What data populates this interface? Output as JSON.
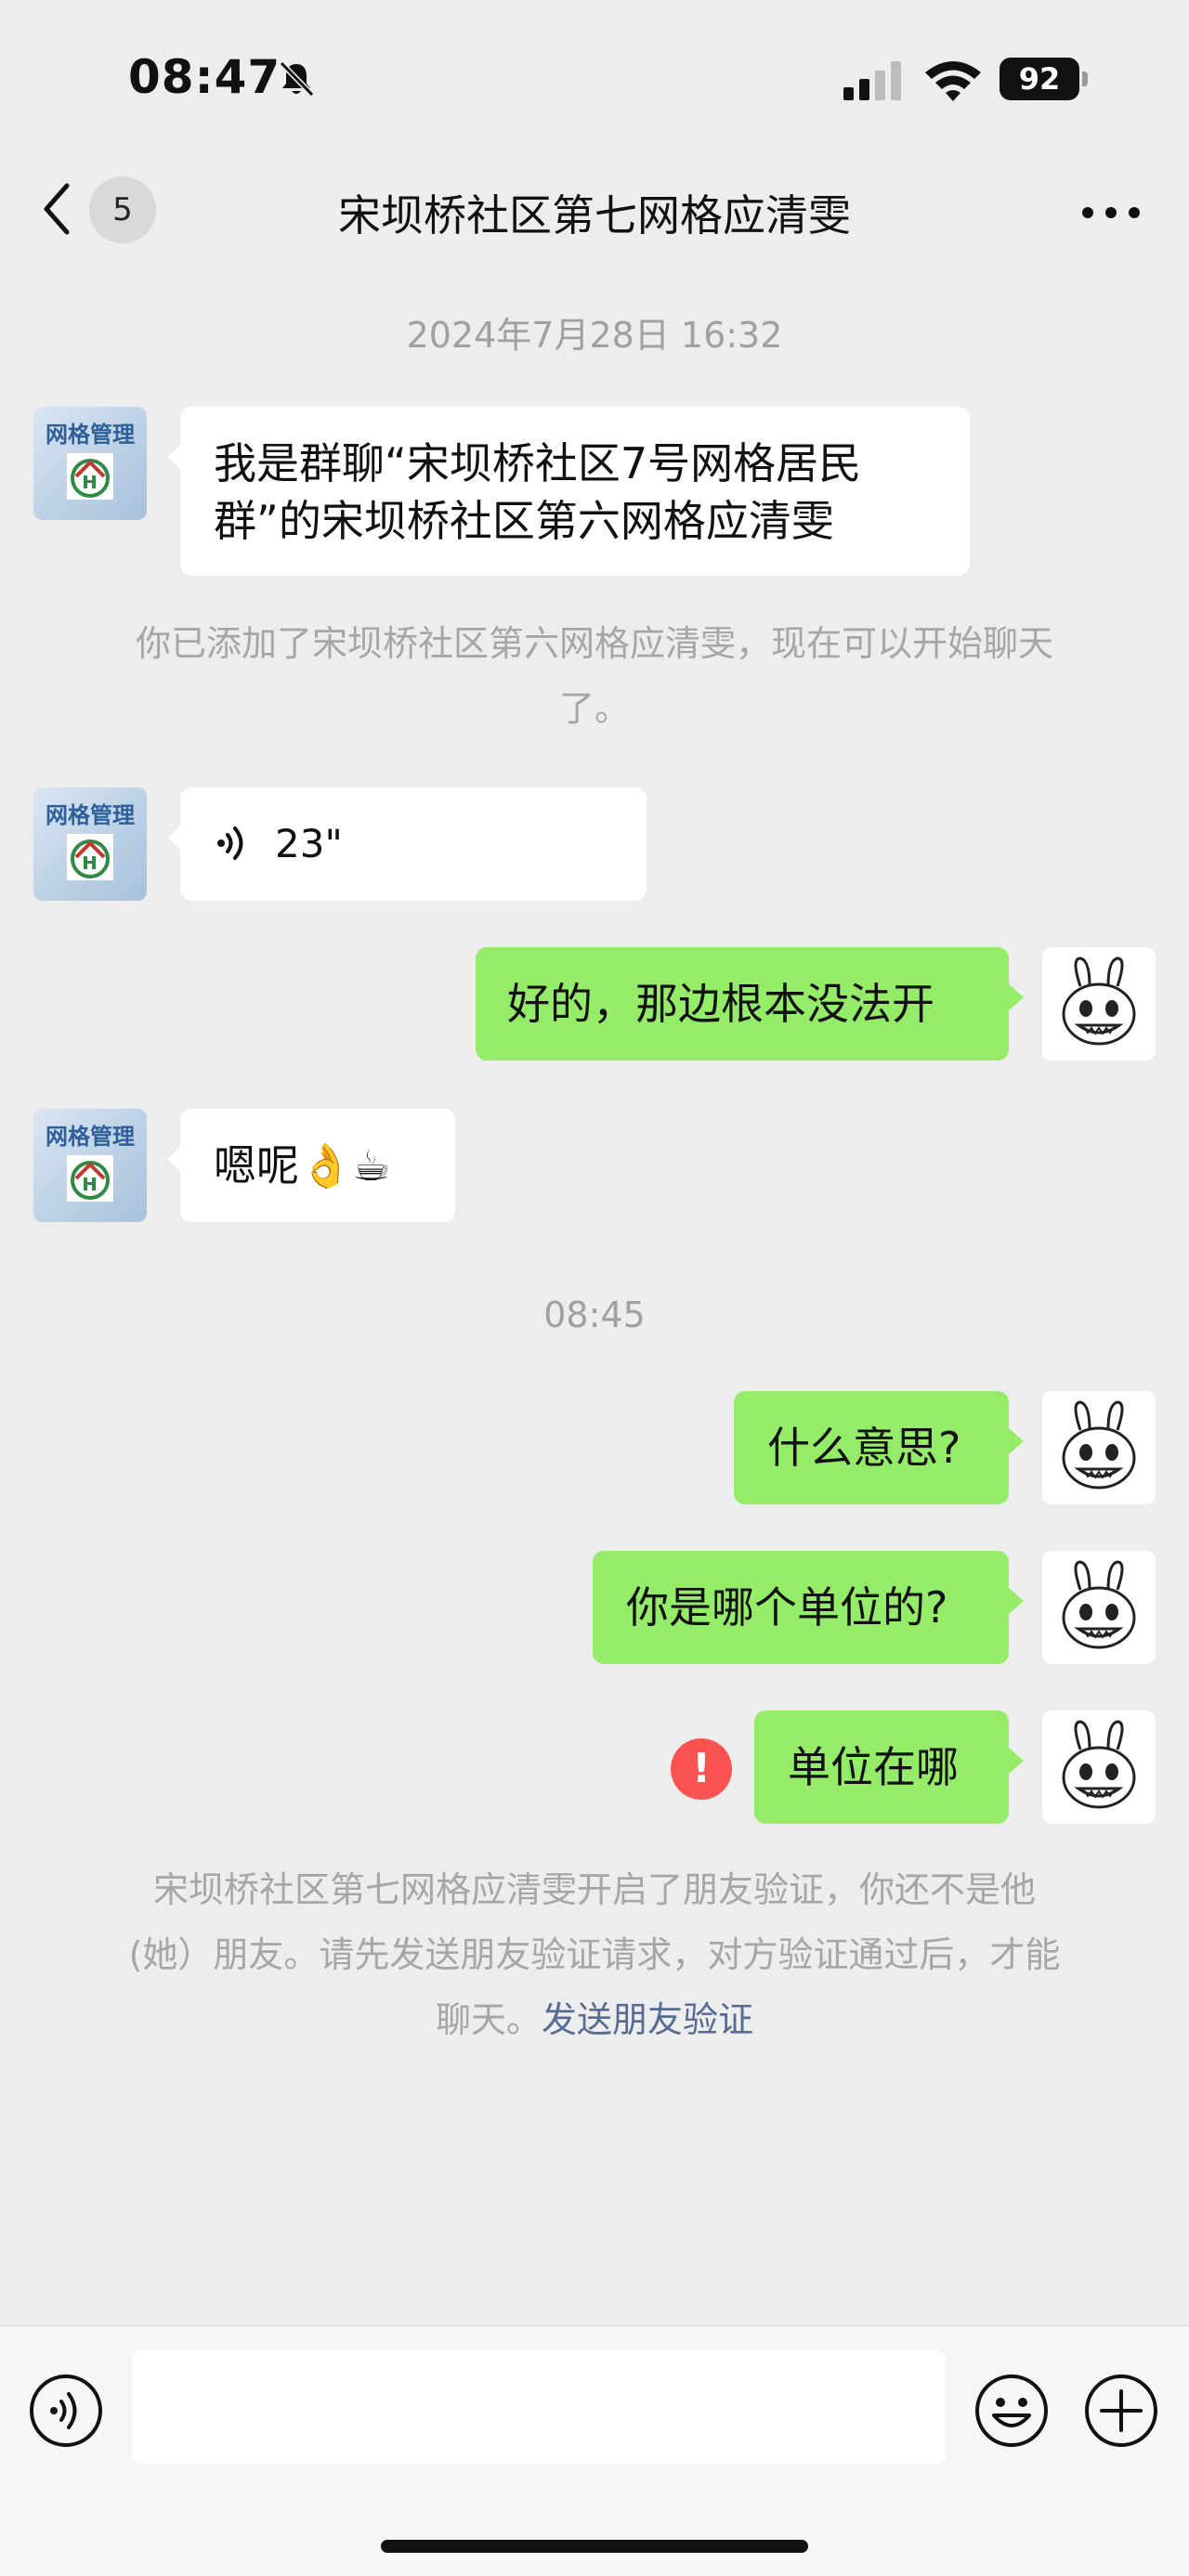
{
  "status_bar": {
    "time": "08:47",
    "battery": "92"
  },
  "header": {
    "unread_count": "5",
    "title": "宋坝桥社区第七网格应清雯"
  },
  "avatar_label": "网格管理",
  "messages": [
    {
      "timestamp": "2024年7月28日 16:32"
    },
    {
      "text": "我是群聊“宋坝桥社区7号网格居民",
      "text2": "群”的宋坝桥社区第六网格应清雯"
    },
    {
      "system1": "你已添加了宋坝桥社区第六网格应清雯，现在可以开始聊天",
      "system2": "了。"
    },
    {
      "voice_duration": "23\""
    },
    {
      "text": "好的，那边根本没法开"
    },
    {
      "text": "嗯呢👌☕"
    },
    {
      "timestamp": "08:45"
    },
    {
      "text": "什么意思?"
    },
    {
      "text": "你是哪个单位的?"
    },
    {
      "text": "单位在哪",
      "error_mark": "!"
    }
  ],
  "footer_notice": {
    "line1": "宋坝桥社区第七网格应清雯开启了朋友验证，你还不是他",
    "line2": "(她）朋友。请先发送朋友验证请求，对方验证通过后，才能",
    "line3": "聊天。",
    "link": "发送朋友验证"
  },
  "input": {
    "placeholder": ""
  },
  "colors": {
    "background": "#ededed",
    "outgoing_bubble": "#95ec69",
    "incoming_bubble": "#ffffff",
    "error": "#fa5151",
    "link": "#576b95"
  }
}
